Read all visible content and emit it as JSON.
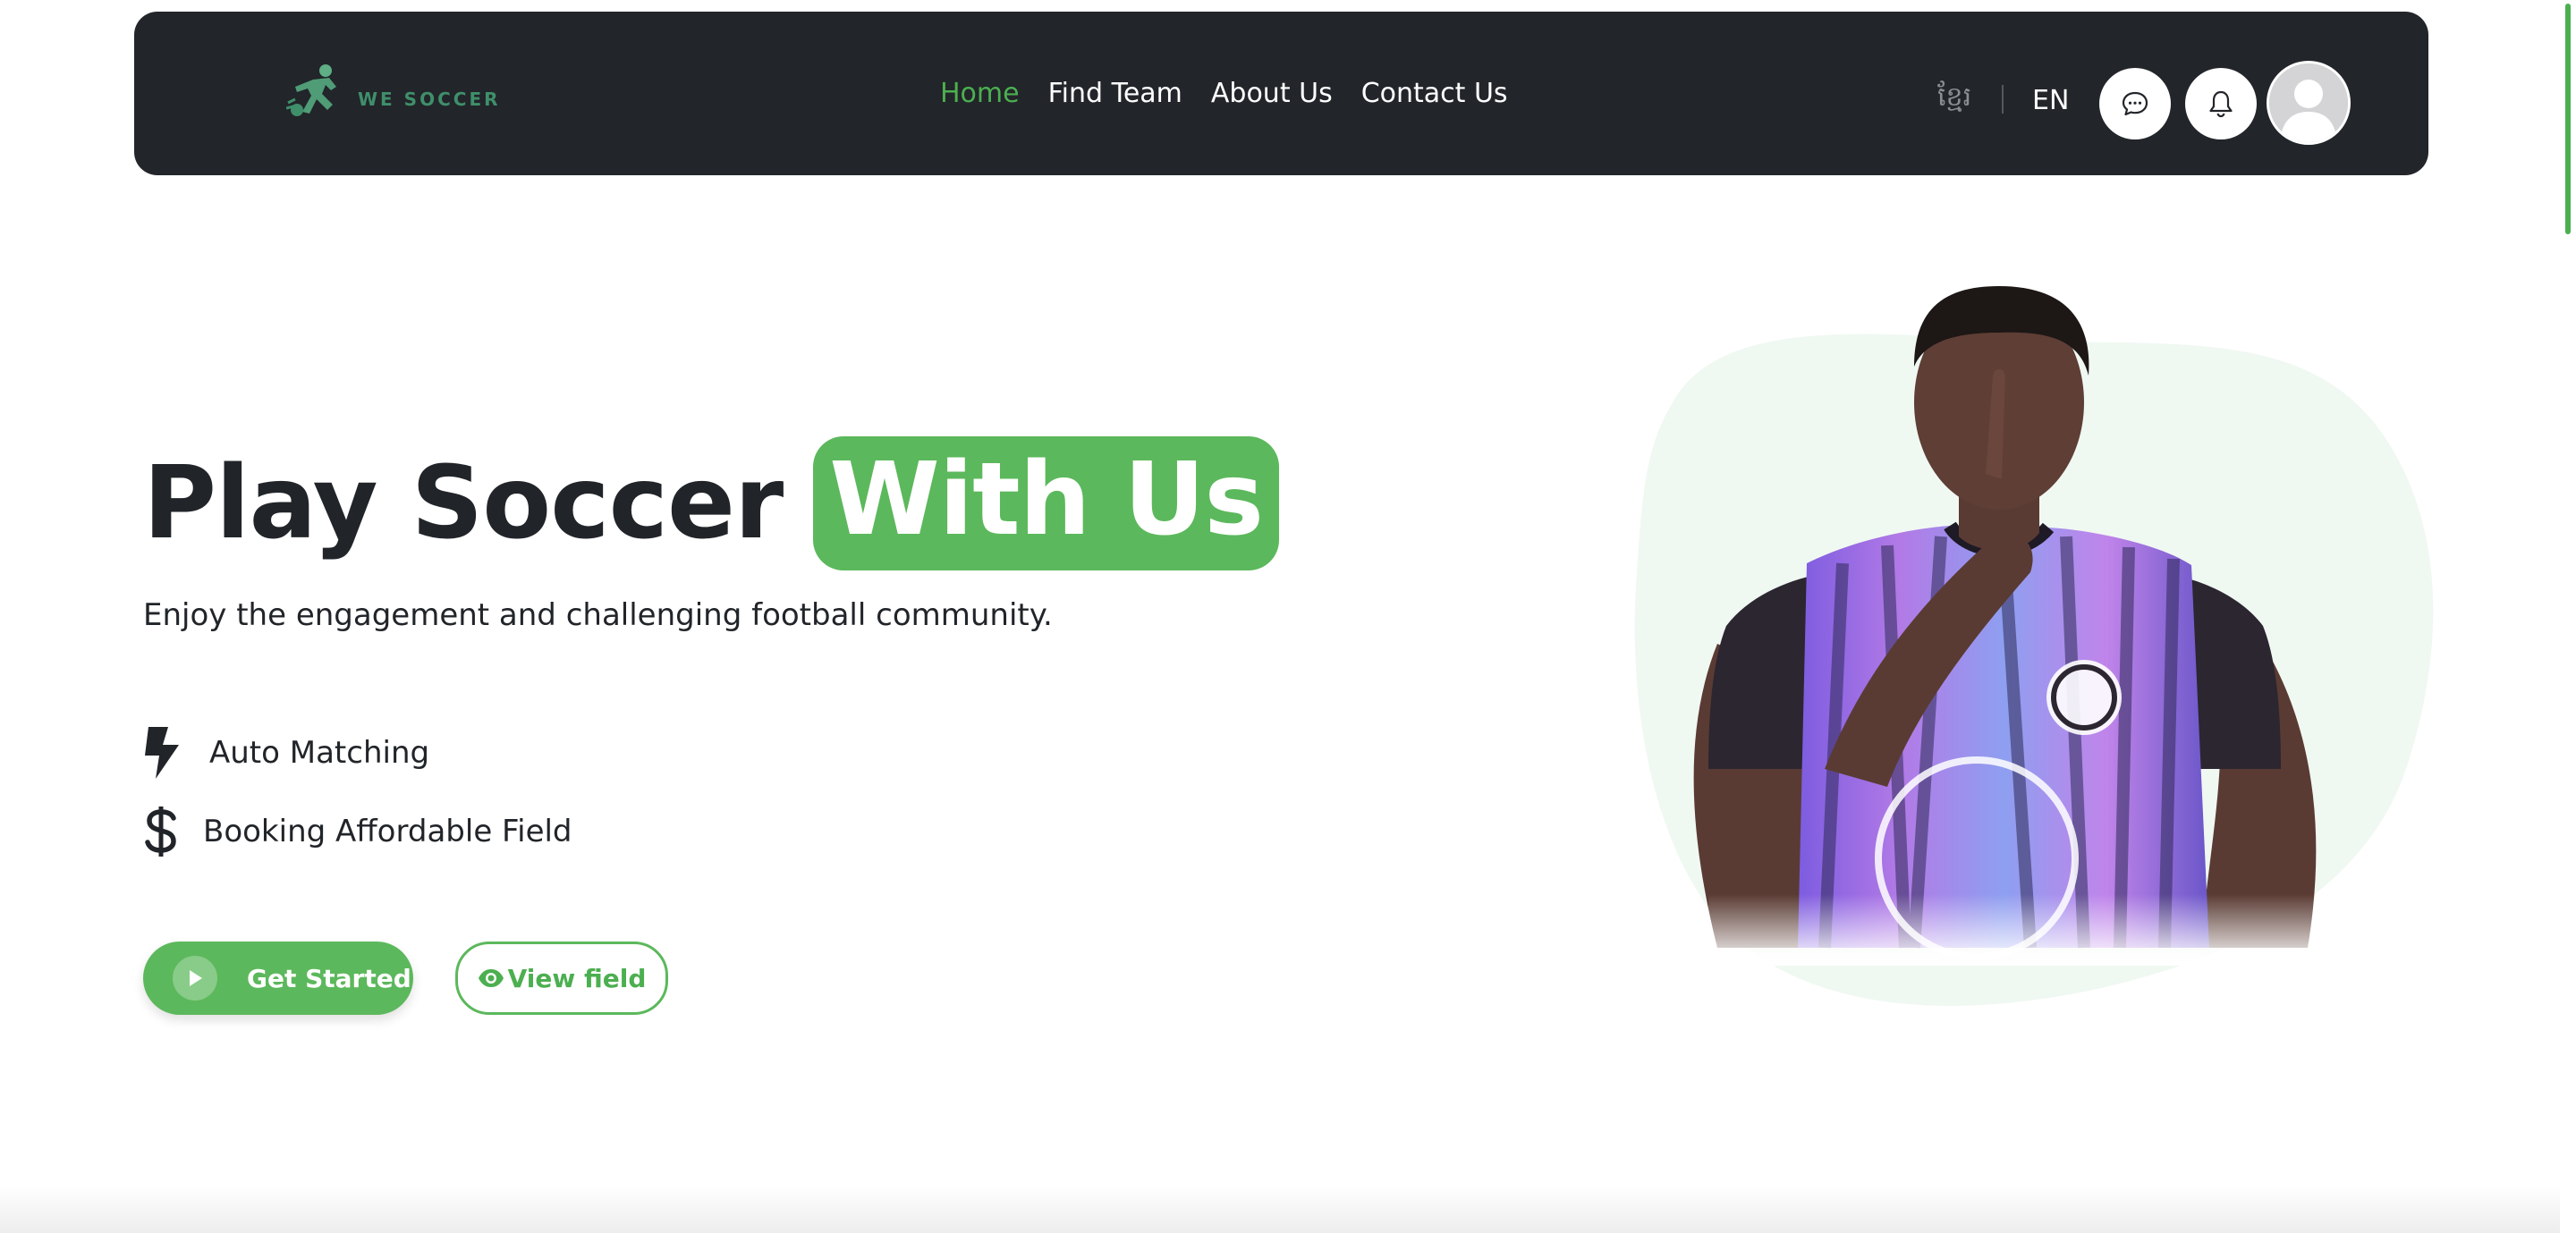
{
  "navbar": {
    "logo_text": "WE SOCCER",
    "links": [
      {
        "label": "Home",
        "active": true
      },
      {
        "label": "Find Team",
        "active": false
      },
      {
        "label": "About Us",
        "active": false
      },
      {
        "label": "Contact Us",
        "active": false
      }
    ],
    "lang_km": "ខ្មែរ",
    "lang_en": "EN",
    "icons": {
      "chat": "chat-bubble-icon",
      "notifications": "bell-icon",
      "profile": "user-avatar-icon"
    }
  },
  "hero": {
    "title": "Play Soccer",
    "title_highlight": "With Us",
    "subtitle": "Enjoy the engagement and challenging football community.",
    "features": [
      {
        "icon": "lightning-bolt-icon",
        "label": "Auto Matching"
      },
      {
        "icon": "dollar-icon",
        "label": "Booking Affordable Field"
      }
    ],
    "primary_button": "Get Started",
    "secondary_button": "View field"
  },
  "theme": {
    "accent": "#5cb85c",
    "accent_text": "#4caf50",
    "nav_bg": "#22252a",
    "hero_blob": "#f0f8f2"
  }
}
